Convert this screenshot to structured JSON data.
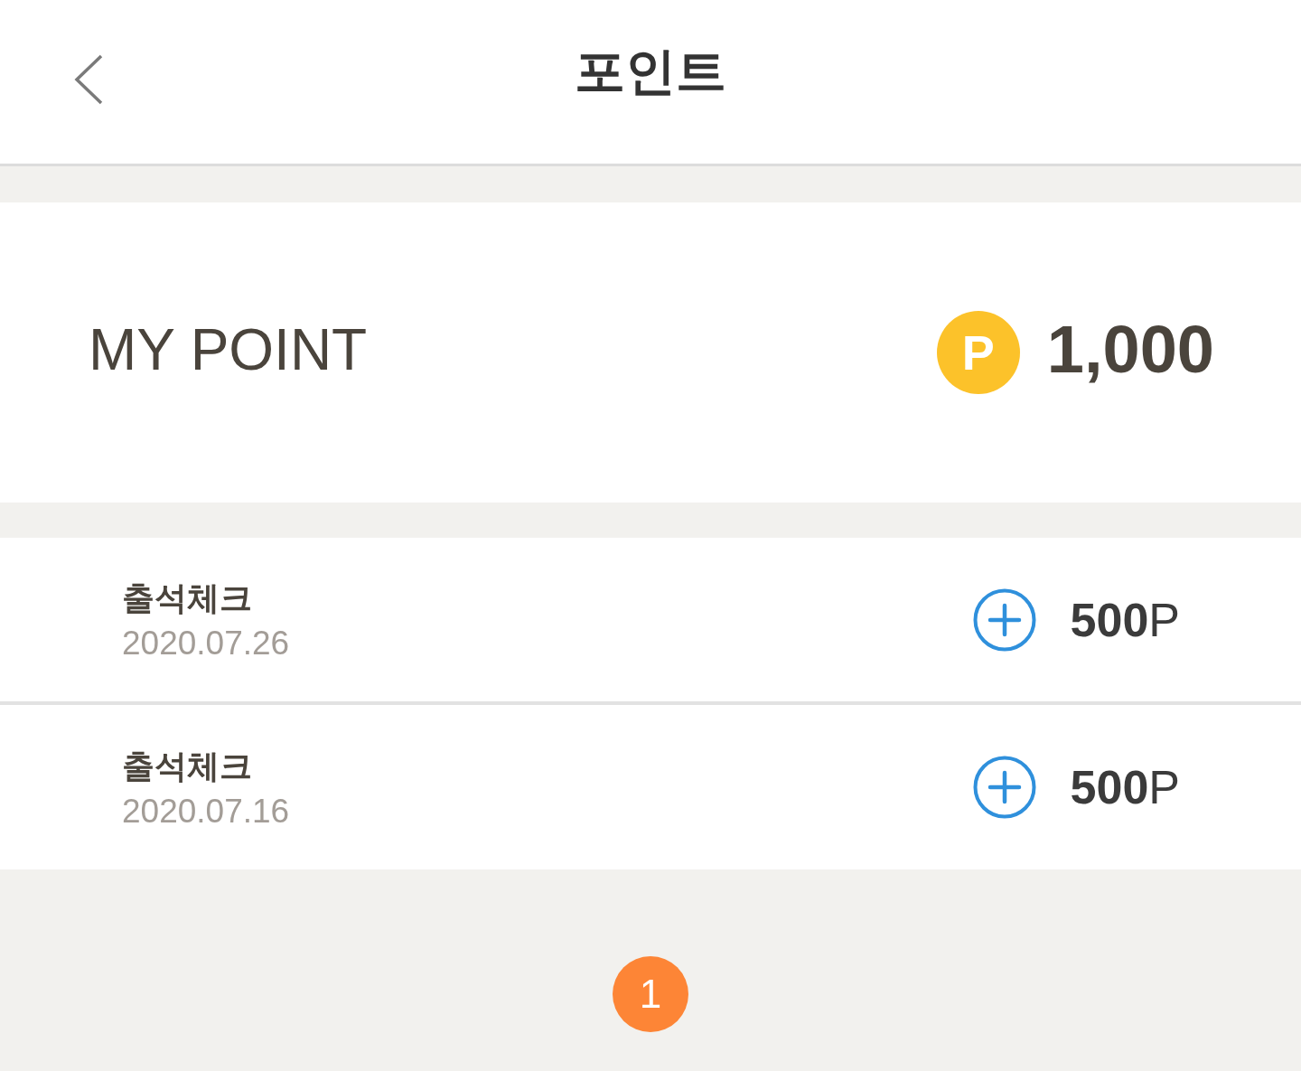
{
  "header": {
    "title": "포인트"
  },
  "summary": {
    "label": "MY POINT",
    "coin": "P",
    "points": "1,000"
  },
  "history": [
    {
      "kind": "earn",
      "title": "출석체크",
      "date": "2020.07.26",
      "amount": "**500**P"
    },
    {
      "kind": "earn",
      "title": "출석체크",
      "date": "2020.07.16",
      "amount": "**500**P"
    }
  ],
  "pagination": [
    {
      "label": "1",
      "selected": true
    }
  ]
}
